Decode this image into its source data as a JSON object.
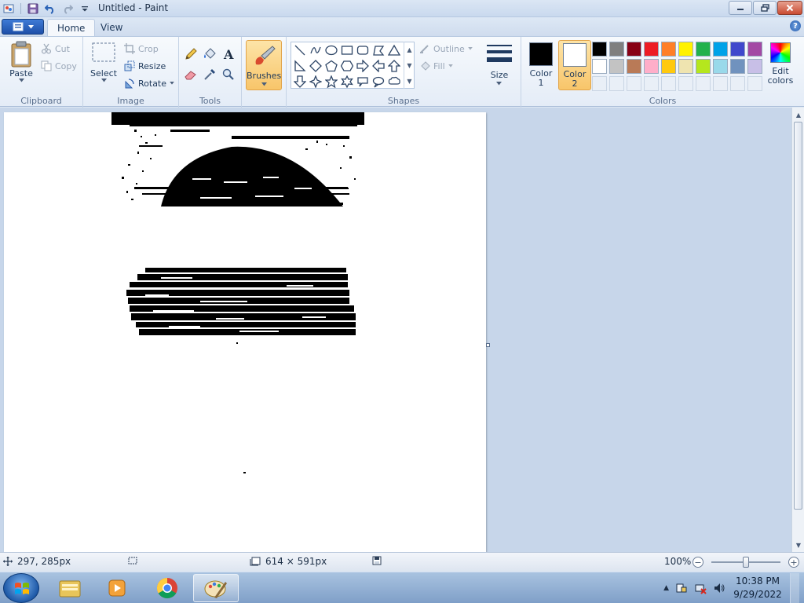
{
  "window": {
    "title": "Untitled - Paint"
  },
  "quick_access": {
    "save": "save-icon",
    "undo": "undo-icon",
    "redo": "redo-icon",
    "customize": "dropdown-arrow-icon"
  },
  "tabs": {
    "home": "Home",
    "view": "View"
  },
  "clipboard": {
    "paste": "Paste",
    "cut": "Cut",
    "copy": "Copy",
    "label": "Clipboard"
  },
  "image": {
    "select": "Select",
    "crop": "Crop",
    "resize": "Resize",
    "rotate": "Rotate",
    "label": "Image"
  },
  "tools": {
    "label": "Tools",
    "items": [
      "pencil-icon",
      "fill-icon",
      "text-icon",
      "eraser-icon",
      "color-picker-icon",
      "magnifier-icon"
    ]
  },
  "brushes": {
    "label": "Brushes"
  },
  "shapes": {
    "label": "Shapes",
    "outline": "Outline",
    "fill": "Fill"
  },
  "size": {
    "label": "Size"
  },
  "colors": {
    "color1_label": "Color\n1",
    "color2_label": "Color\n2",
    "label": "Colors",
    "edit_colors": "Edit\ncolors",
    "color1": "#000000",
    "color2": "#ffffff",
    "palette_row1": [
      "#000000",
      "#7f7f7f",
      "#880015",
      "#ed1c24",
      "#ff7f27",
      "#fff200",
      "#22b14c",
      "#00a2e8",
      "#3f48cc",
      "#a349a4"
    ],
    "palette_row2": [
      "#ffffff",
      "#c3c3c3",
      "#b97a57",
      "#ffaec9",
      "#ffc90e",
      "#efe4b0",
      "#b5e61d",
      "#99d9ea",
      "#7092be",
      "#c8bfe7"
    ]
  },
  "status": {
    "cursor_pos": "297, 285px",
    "selection_size": "",
    "canvas_size": "614 × 591px",
    "zoom": "100%"
  },
  "taskbar": {
    "clock_time": "10:38 PM",
    "clock_date": "9/29/2022"
  }
}
